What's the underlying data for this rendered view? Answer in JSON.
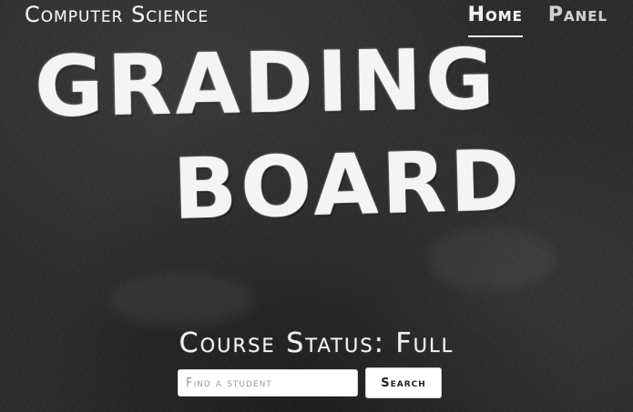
{
  "header": {
    "brand": "Computer Science",
    "nav": [
      {
        "label": "Home",
        "active": true
      },
      {
        "label": "Panel",
        "active": false
      }
    ]
  },
  "hero": {
    "title_line_1": "Grading",
    "title_line_2": "Board"
  },
  "course": {
    "status_text": "Course Status: Full"
  },
  "search": {
    "placeholder": "Find a student",
    "value": "",
    "button_label": "Search"
  },
  "colors": {
    "chalkboard": "#2b2b2b",
    "chalk": "#f2f2f2"
  }
}
